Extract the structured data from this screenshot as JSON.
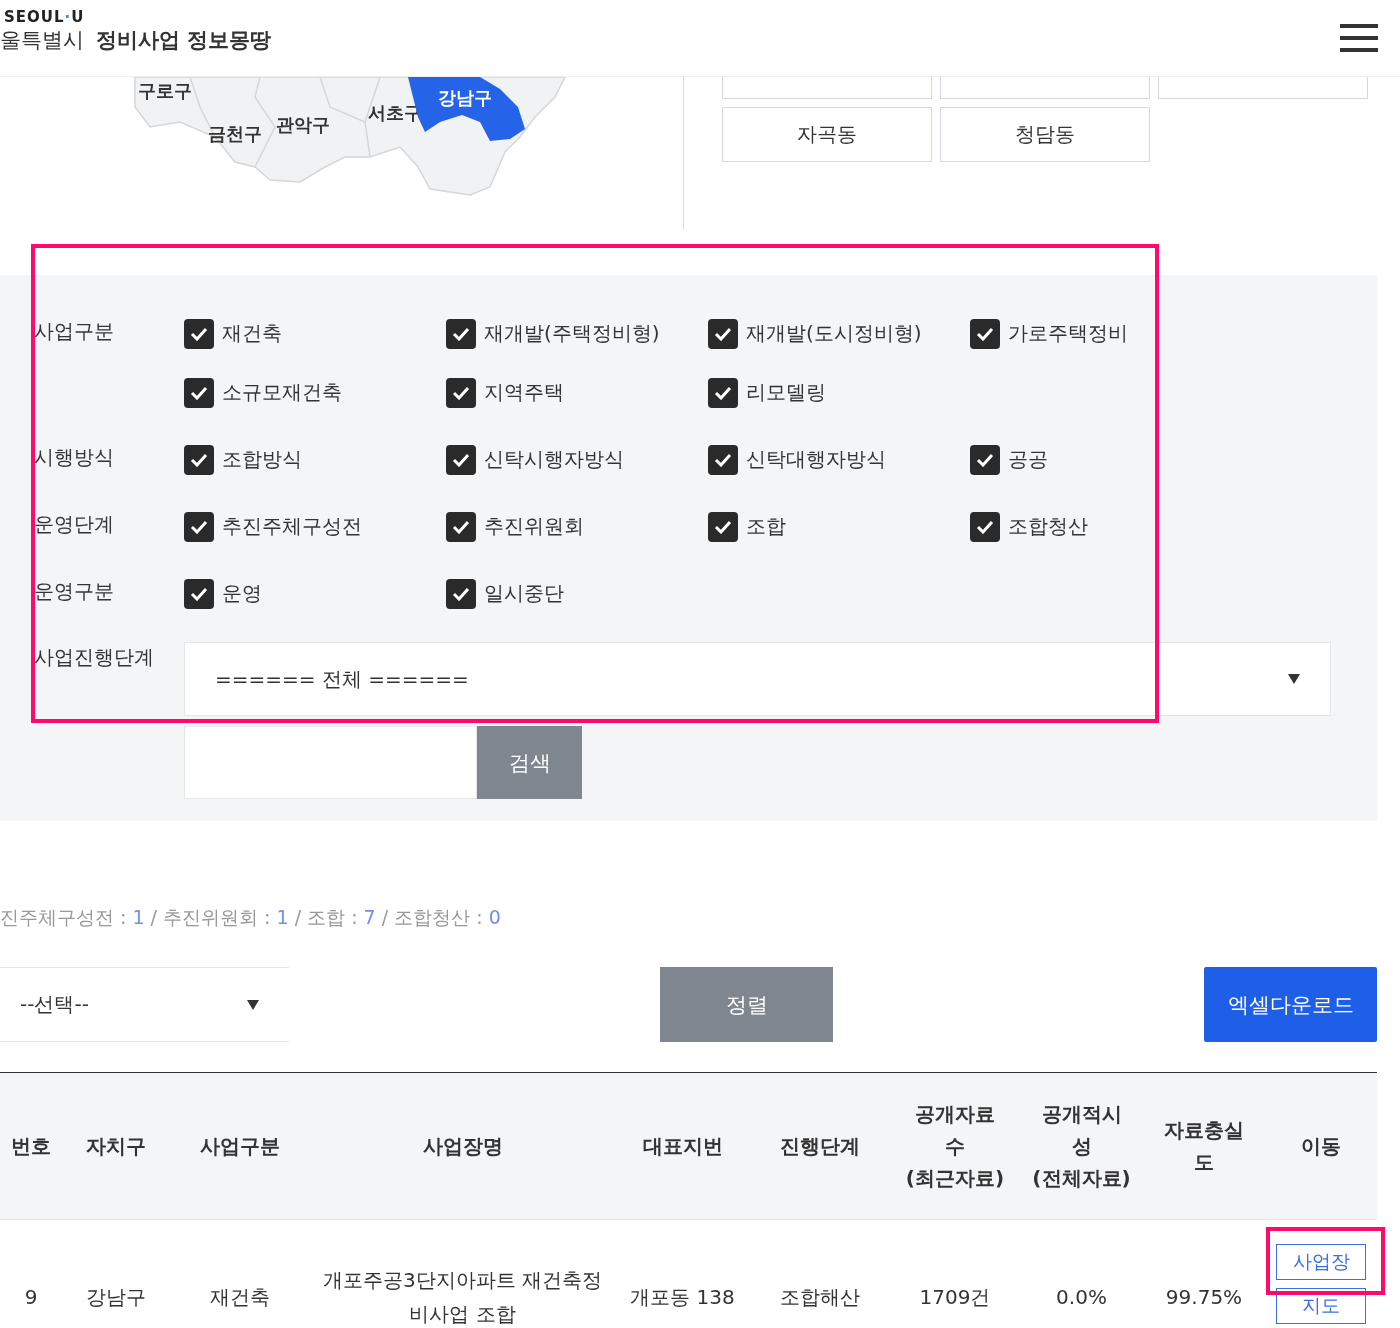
{
  "header": {
    "logo": {
      "word": "SEOUL",
      "separator": "·",
      "suffix": "U"
    },
    "city": "울특별시",
    "title": "정비사업 정보몽땅"
  },
  "map": {
    "districts": [
      {
        "name": "구로구",
        "selected": false
      },
      {
        "name": "금천구",
        "selected": false
      },
      {
        "name": "관악구",
        "selected": false
      },
      {
        "name": "서초구",
        "selected": false
      },
      {
        "name": "강남구",
        "selected": true
      }
    ]
  },
  "dong_buttons": [
    {
      "label": "자곡동"
    },
    {
      "label": "청담동"
    }
  ],
  "filters": [
    {
      "label": "사업구분",
      "options": [
        {
          "label": "재건축",
          "checked": true
        },
        {
          "label": "재개발(주택정비형)",
          "checked": true
        },
        {
          "label": "재개발(도시정비형)",
          "checked": true
        },
        {
          "label": "가로주택정비",
          "checked": true
        },
        {
          "label": "소규모재건축",
          "checked": true
        },
        {
          "label": "지역주택",
          "checked": true
        },
        {
          "label": "리모델링",
          "checked": true
        }
      ]
    },
    {
      "label": "시행방식",
      "options": [
        {
          "label": "조합방식",
          "checked": true
        },
        {
          "label": "신탁시행자방식",
          "checked": true
        },
        {
          "label": "신탁대행자방식",
          "checked": true
        },
        {
          "label": "공공",
          "checked": true
        }
      ]
    },
    {
      "label": "운영단계",
      "options": [
        {
          "label": "추진주체구성전",
          "checked": true
        },
        {
          "label": "추진위원회",
          "checked": true
        },
        {
          "label": "조합",
          "checked": true
        },
        {
          "label": "조합청산",
          "checked": true
        }
      ]
    },
    {
      "label": "운영구분",
      "options": [
        {
          "label": "운영",
          "checked": true
        },
        {
          "label": "일시중단",
          "checked": true
        }
      ]
    }
  ],
  "stage": {
    "label": "사업진행단계",
    "value": "====== 전체 ======"
  },
  "search_button": "검색",
  "summary": [
    {
      "text": "진주체구성전 : ",
      "kind": "label"
    },
    {
      "text": "1",
      "kind": "count"
    },
    {
      "text": " / 추진위원회 : ",
      "kind": "label"
    },
    {
      "text": "1",
      "kind": "count"
    },
    {
      "text": " / 조합 : ",
      "kind": "label"
    },
    {
      "text": "7",
      "kind": "count"
    },
    {
      "text": " / 조합청산 : ",
      "kind": "label"
    },
    {
      "text": "0",
      "kind": "count"
    }
  ],
  "sort_select": "--선택--",
  "sort_button": "정렬",
  "excel_button": "엑셀다운로드",
  "table": {
    "columns": [
      "번호",
      "자치구",
      "사업구분",
      "사업장명",
      "대표지번",
      "진행단계",
      "공개자료수 (최근자료)",
      "공개적시성 (전체자료)",
      "자료충실도",
      "이동"
    ],
    "rows": [
      {
        "cells": [
          "9",
          "강남구",
          "재건축",
          "개포주공3단지아파트 재건축정비사업 조합",
          "개포동 138",
          "조합해산",
          "1709건",
          "0.0%",
          "99.75%"
        ],
        "actions": [
          "사업장",
          "지도"
        ]
      }
    ]
  },
  "annotations": [
    {
      "kind": "highlight"
    },
    {
      "kind": "highlight"
    }
  ]
}
